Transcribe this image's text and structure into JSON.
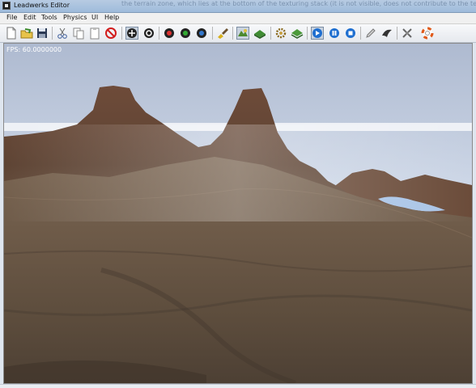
{
  "window": {
    "title": "Leadwerks Editor",
    "background_text": "the terrain zone, which lies at the bottom of the texturing stack (it is not visible, does not contribute to the texture"
  },
  "menu": [
    "File",
    "Edit",
    "Tools",
    "Physics",
    "UI",
    "Help"
  ],
  "toolbar": {
    "groups": [
      [
        "new-file-icon",
        "open-folder-icon",
        "save-icon"
      ],
      [
        "cut-icon",
        "copy-icon",
        "paste-icon",
        "delete-icon"
      ],
      [
        "move-icon",
        "rotate-icon"
      ],
      [
        "target-red-icon",
        "target-green-icon",
        "target-blue-icon"
      ],
      [
        "brush-icon"
      ],
      [
        "terrain-select-icon",
        "terrain-paint-icon"
      ],
      [
        "gear-icon",
        "terrain-layer-icon"
      ],
      [
        "play-icon",
        "pause-icon",
        "stop-icon"
      ],
      [
        "pencil-icon",
        "script-icon"
      ],
      [
        "tools-icon",
        "help-icon"
      ]
    ]
  },
  "viewport": {
    "fps_label": "FPS: 60.0000000",
    "sky_color": "#c9d6e9",
    "terrain_color": "#6b5a4a"
  }
}
